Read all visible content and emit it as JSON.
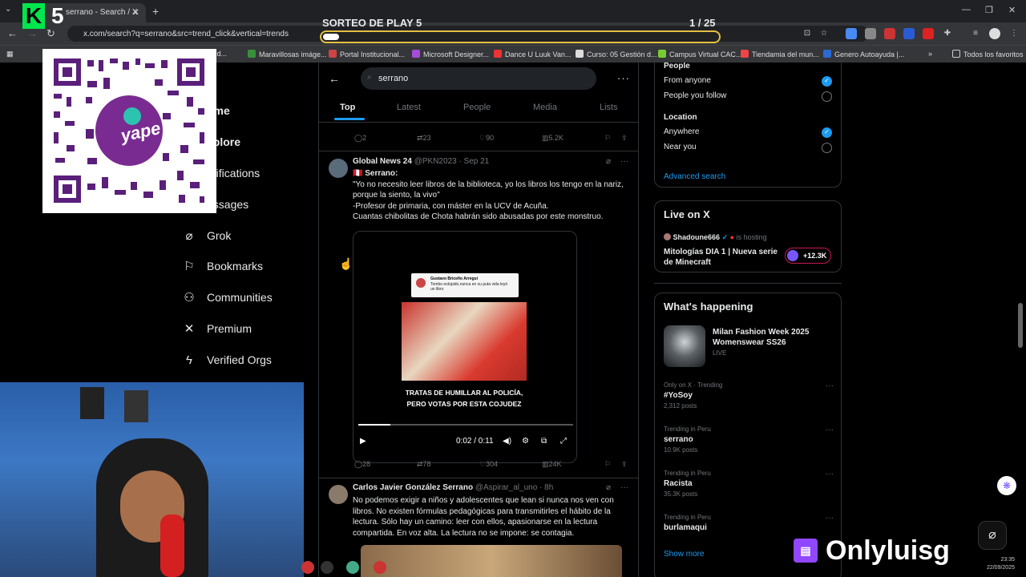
{
  "browser": {
    "tab_title": "serrano - Search / X",
    "url": "x.com/search?q=serrano&src=trend_click&vertical=trends",
    "bookmarks": [
      "ón d...",
      "Maravillosas imáge...",
      "Portal Institucional...",
      "Microsoft Designer...",
      "Dance U Luuk Van...",
      "Curso: 05 Gestión d...",
      "Campus Virtual CAC...",
      "Tiendamia del mun...",
      "Genero Autoayuda |..."
    ],
    "bookmarks_folder": "Todos los favoritos"
  },
  "overlay": {
    "sorteo_title": "SORTEO DE PLAY 5",
    "sorteo_count": "1   / 25",
    "sorteo_progress": 0.04,
    "qr_logo_text": "yape",
    "brand_name": "Onlyluisg",
    "clock_time": "23:35",
    "clock_date": "22/09/2025"
  },
  "nav": {
    "items": [
      {
        "label": "ome",
        "icon": "home-icon"
      },
      {
        "label": "xplore",
        "icon": "search-icon"
      },
      {
        "label": "otifications",
        "icon": "bell-icon"
      },
      {
        "label": "essages",
        "icon": "mail-icon"
      },
      {
        "label": "Grok",
        "icon": "grok-icon"
      },
      {
        "label": "Bookmarks",
        "icon": "bookmark-icon"
      },
      {
        "label": "Communities",
        "icon": "communities-icon"
      },
      {
        "label": "Premium",
        "icon": "x-logo-icon"
      },
      {
        "label": "Verified Orgs",
        "icon": "lightning-icon"
      }
    ]
  },
  "search": {
    "query": "serrano",
    "tabs": [
      "Top",
      "Latest",
      "People",
      "Media",
      "Lists"
    ],
    "active_tab": "Top"
  },
  "tweets": [
    {
      "stats": {
        "replies": "2",
        "reposts": "23",
        "likes": "90",
        "views": "5.2K"
      }
    },
    {
      "name": "Global News 24",
      "handle": "@PKN2023 · Sep 21",
      "lines": [
        "🇵🇪 Serrano:",
        "\"Yo no necesito leer libros de la biblioteca, yo los libros los tengo en la nariz, porque la siento, la vivo\"",
        "-Profesor de primaria, con máster en la UCV de Acuña.",
        "Cuantas chibolitas de Chota habrán sido abusadas por este monstruo."
      ],
      "video": {
        "card_name": "Gustavo Briceño Arregui",
        "card_text": "Tombo estúpido,nunca en su puta vida leyó un libro",
        "caption_line1": "TRATAS DE HUMILLAR AL POLICÍA,",
        "caption_line2": "PERO VOTAS POR ESTA COJUDEZ",
        "time": "0:02 / 0:11",
        "progress": 0.15
      },
      "stats": {
        "replies": "28",
        "reposts": "78",
        "likes": "304",
        "views": "24K"
      }
    },
    {
      "name": "Carlos Javier González Serrano",
      "handle": "@Aspirar_al_uno · 8h",
      "lines": [
        "No podemos exigir a niños y adolescentes que lean si nunca nos ven con libros. No existen fórmulas pedagógicas para transmitirles el hábito de la lectura. Sólo hay un camino: leer con ellos, apasionarse en la lectura compartida. En voz alta. La lectura no se impone: se contagia."
      ]
    }
  ],
  "filters": {
    "people_label": "People",
    "people_options": [
      "From anyone",
      "People you follow"
    ],
    "location_label": "Location",
    "location_options": [
      "Anywhere",
      "Near you"
    ],
    "advanced": "Advanced search"
  },
  "live": {
    "heading": "Live on X",
    "host": "Shadoune666",
    "hosting": "is hosting",
    "title": "Mitologías DIA 1 | Nueva serie de Minecraft",
    "count": "+12.3K"
  },
  "happening": {
    "heading": "What's happening",
    "featured_title": "Milan Fashion Week 2025 Womenswear SS26",
    "featured_status": "LIVE",
    "trends": [
      {
        "meta": "Only on X · Trending",
        "name": "#YoSoy",
        "posts": "2,312 posts"
      },
      {
        "meta": "Trending in Peru",
        "name": "serrano",
        "posts": "10.9K posts"
      },
      {
        "meta": "Trending in Peru",
        "name": "Racista",
        "posts": "35.3K posts"
      },
      {
        "meta": "Trending in Peru",
        "name": "burlamaqui",
        "posts": ""
      }
    ],
    "show_more": "Show more"
  },
  "colors": {
    "accent": "#1d9bf0",
    "background": "#000000",
    "border": "#2f3336",
    "muted": "#71767b",
    "live_pink": "#c91657",
    "brand_purple": "#9146ff"
  }
}
